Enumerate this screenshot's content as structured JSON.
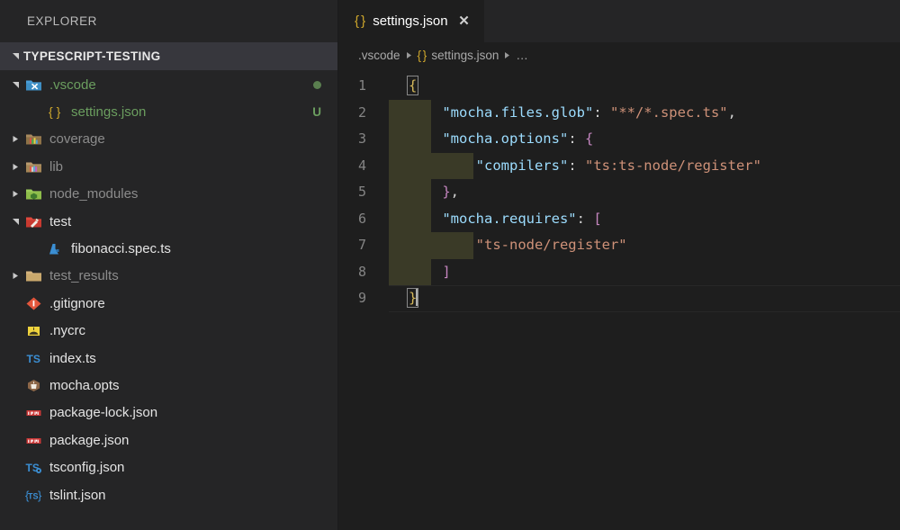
{
  "sidebar": {
    "title": "EXPLORER",
    "root": {
      "label": "TYPESCRIPT-TESTING",
      "expanded": true
    },
    "items": [
      {
        "label": ".vscode",
        "icon": "folder-vscode-icon",
        "kind": "folder",
        "depth": 1,
        "state": "expanded",
        "color": "green",
        "git": "dot"
      },
      {
        "label": "settings.json",
        "icon": "json-braces-icon",
        "kind": "file",
        "depth": 2,
        "state": "leaf",
        "color": "green",
        "git": "U"
      },
      {
        "label": "coverage",
        "icon": "folder-coverage-icon",
        "kind": "folder",
        "depth": 1,
        "state": "collapsed",
        "color": "dim",
        "git": ""
      },
      {
        "label": "lib",
        "icon": "folder-lib-icon",
        "kind": "folder",
        "depth": 1,
        "state": "collapsed",
        "color": "dim",
        "git": ""
      },
      {
        "label": "node_modules",
        "icon": "folder-node-icon",
        "kind": "folder",
        "depth": 1,
        "state": "collapsed",
        "color": "dim",
        "git": ""
      },
      {
        "label": "test",
        "icon": "folder-test-icon",
        "kind": "folder",
        "depth": 1,
        "state": "expanded",
        "color": "bright",
        "git": ""
      },
      {
        "label": "fibonacci.spec.ts",
        "icon": "test-file-icon",
        "kind": "file",
        "depth": 2,
        "state": "leaf",
        "color": "bright",
        "git": ""
      },
      {
        "label": "test_results",
        "icon": "folder-plain-icon",
        "kind": "folder",
        "depth": 1,
        "state": "collapsed",
        "color": "dim",
        "git": ""
      },
      {
        "label": ".gitignore",
        "icon": "git-icon",
        "kind": "file",
        "depth": 1,
        "state": "leaf",
        "color": "bright",
        "git": ""
      },
      {
        "label": ".nycrc",
        "icon": "nyc-icon",
        "kind": "file",
        "depth": 1,
        "state": "leaf",
        "color": "bright",
        "git": ""
      },
      {
        "label": "index.ts",
        "icon": "typescript-icon",
        "kind": "file",
        "depth": 1,
        "state": "leaf",
        "color": "bright",
        "git": ""
      },
      {
        "label": "mocha.opts",
        "icon": "mocha-icon",
        "kind": "file",
        "depth": 1,
        "state": "leaf",
        "color": "bright",
        "git": ""
      },
      {
        "label": "package-lock.json",
        "icon": "npm-icon",
        "kind": "file",
        "depth": 1,
        "state": "leaf",
        "color": "bright",
        "git": ""
      },
      {
        "label": "package.json",
        "icon": "npm-icon",
        "kind": "file",
        "depth": 1,
        "state": "leaf",
        "color": "bright",
        "git": ""
      },
      {
        "label": "tsconfig.json",
        "icon": "tsconfig-icon",
        "kind": "file",
        "depth": 1,
        "state": "leaf",
        "color": "bright",
        "git": ""
      },
      {
        "label": "tslint.json",
        "icon": "tslint-icon",
        "kind": "file",
        "depth": 1,
        "state": "leaf",
        "color": "bright",
        "git": ""
      }
    ]
  },
  "editor": {
    "tab": {
      "label": "settings.json",
      "icon": "json-braces-icon",
      "close_label": "✕",
      "active": true
    },
    "breadcrumb": [
      {
        "label": ".vscode",
        "icon": ""
      },
      {
        "label": "settings.json",
        "icon": "json-braces-icon"
      },
      {
        "label": "…",
        "icon": ""
      }
    ],
    "cursor_line": 9,
    "lines": [
      {
        "n": 1,
        "indent_blocks": 0,
        "tokens": [
          {
            "t": "{",
            "c": "brace-match"
          }
        ]
      },
      {
        "n": 2,
        "indent_blocks": 1,
        "tokens": [
          {
            "t": "\"mocha.files.glob\"",
            "c": "k-prop"
          },
          {
            "t": ": ",
            "c": "k-punc"
          },
          {
            "t": "\"**/*.spec.ts\"",
            "c": "k-str"
          },
          {
            "t": ",",
            "c": "k-punc"
          }
        ]
      },
      {
        "n": 3,
        "indent_blocks": 1,
        "tokens": [
          {
            "t": "\"mocha.options\"",
            "c": "k-prop"
          },
          {
            "t": ": ",
            "c": "k-punc"
          },
          {
            "t": "{",
            "c": "k-brace"
          }
        ]
      },
      {
        "n": 4,
        "indent_blocks": 2,
        "tokens": [
          {
            "t": "\"compilers\"",
            "c": "k-prop"
          },
          {
            "t": ": ",
            "c": "k-punc"
          },
          {
            "t": "\"ts:ts-node/register\"",
            "c": "k-str"
          }
        ]
      },
      {
        "n": 5,
        "indent_blocks": 1,
        "tokens": [
          {
            "t": "}",
            "c": "k-brace"
          },
          {
            "t": ",",
            "c": "k-punc"
          }
        ]
      },
      {
        "n": 6,
        "indent_blocks": 1,
        "tokens": [
          {
            "t": "\"mocha.requires\"",
            "c": "k-prop"
          },
          {
            "t": ": ",
            "c": "k-punc"
          },
          {
            "t": "[",
            "c": "k-brace"
          }
        ]
      },
      {
        "n": 7,
        "indent_blocks": 2,
        "tokens": [
          {
            "t": "\"ts-node/register\"",
            "c": "k-str"
          }
        ]
      },
      {
        "n": 8,
        "indent_blocks": 1,
        "tokens": [
          {
            "t": "]",
            "c": "k-brace"
          }
        ]
      },
      {
        "n": 9,
        "indent_blocks": 0,
        "tokens": [
          {
            "t": "}",
            "c": "brace-match"
          }
        ]
      }
    ]
  },
  "colors": {
    "editor_bg": "#1e1e1e",
    "sidebar_bg": "#252526",
    "root_row_bg": "#37373d",
    "property": "#9cdcfe",
    "string": "#ce9178",
    "brace": "#c586c0",
    "brace_match": "#d7ba5c",
    "git_untracked": "#6b9e5f",
    "line_number": "#858585",
    "indent_highlight": "#3a3a27"
  }
}
